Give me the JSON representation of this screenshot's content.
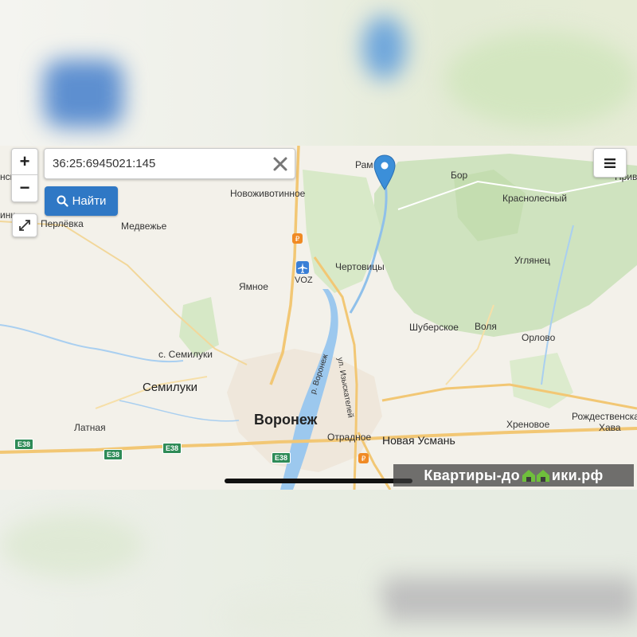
{
  "search": {
    "value": "36:25:6945021:145"
  },
  "buttons": {
    "find_label": "Найти",
    "zoom_in": "+",
    "zoom_out": "−"
  },
  "map": {
    "labels": [
      {
        "id": "ramon",
        "text": "Рам"
      },
      {
        "id": "bor",
        "text": "Бор"
      },
      {
        "id": "krasnolesny",
        "text": "Краснолесный"
      },
      {
        "id": "novozhivotinnoe",
        "text": "Новоживотинное"
      },
      {
        "id": "perlyovka",
        "text": "Перлёвка"
      },
      {
        "id": "medvezhye",
        "text": "Медвежье"
      },
      {
        "id": "chertovitsy",
        "text": "Чертовицы"
      },
      {
        "id": "voz",
        "text": "VOZ"
      },
      {
        "id": "yamnoe",
        "text": "Ямное"
      },
      {
        "id": "uglyanets",
        "text": "Углянец"
      },
      {
        "id": "shuberskoe",
        "text": "Шуберское"
      },
      {
        "id": "volya",
        "text": "Воля"
      },
      {
        "id": "orlovo",
        "text": "Орлово"
      },
      {
        "id": "s_semiluki",
        "text": "с. Семилуки"
      },
      {
        "id": "semiluki",
        "text": "Семилуки"
      },
      {
        "id": "voronezh",
        "text": "Воронеж"
      },
      {
        "id": "latnaya",
        "text": "Латная"
      },
      {
        "id": "otradnoe",
        "text": "Отрадное"
      },
      {
        "id": "novaya_usman",
        "text": "Новая Усмань"
      },
      {
        "id": "khrenovoe",
        "text": "Хреновое"
      },
      {
        "id": "rozhdestvenskaya",
        "text": "Рождественская"
      },
      {
        "id": "khava",
        "text": "Хава"
      },
      {
        "id": "izyskateley",
        "text": "ул. Изыскателей"
      },
      {
        "id": "r_voronezh",
        "text": "р. Воронеж"
      },
      {
        "id": "edge_nsk",
        "text": "нск"
      },
      {
        "id": "edge_prive",
        "text": "Приве"
      },
      {
        "id": "edge_ink",
        "text": "инк"
      }
    ],
    "road_shields": [
      "E38",
      "E38",
      "E38",
      "E38"
    ],
    "icons": [
      "airport-icon",
      "fuel-icon",
      "location-pin-icon"
    ]
  },
  "watermark": {
    "before": "Квартиры-до",
    "after": "ики.рф"
  },
  "colors": {
    "accent": "#2f78c5",
    "pin": "#3b8fd9",
    "forest": "#cfe3bf",
    "water": "#9cc8ee",
    "road": "#f2c774",
    "shield": "#2e8b57"
  }
}
